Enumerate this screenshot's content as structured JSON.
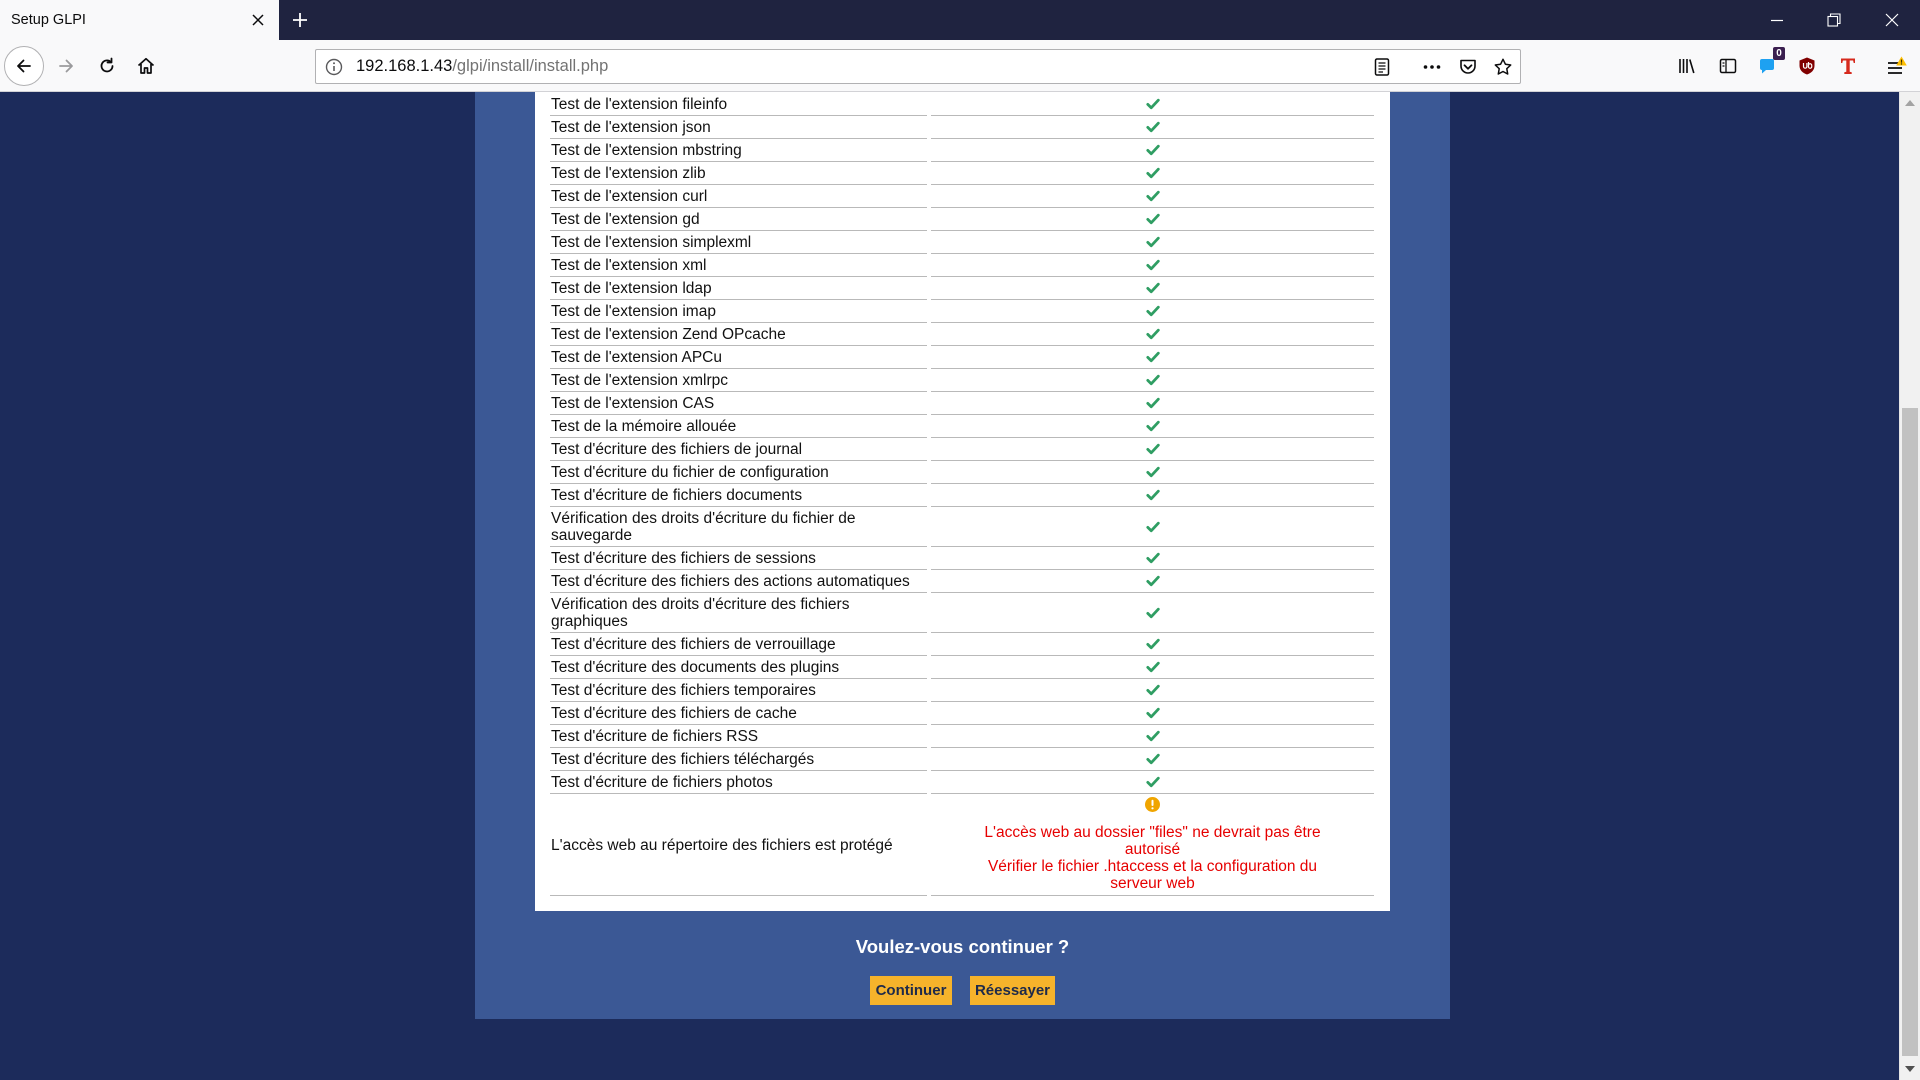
{
  "browser": {
    "tab_title": "Setup GLPI",
    "url_host": "192.168.1.43",
    "url_path": "/glpi/install/install.php",
    "extension_badge": "0",
    "toolbar_icons": [
      "back-icon",
      "forward-icon",
      "reload-icon",
      "home-icon",
      "site-info-icon",
      "reader-view-icon",
      "page-actions-icon",
      "pocket-icon",
      "bookmark-star-icon",
      "library-icon",
      "sidebar-icon",
      "extension-icon",
      "ublock-icon",
      "t-extension-icon",
      "menu-icon"
    ]
  },
  "page": {
    "checks": [
      {
        "label": "Test de l'extension fileinfo",
        "status": "ok"
      },
      {
        "label": "Test de l'extension json",
        "status": "ok"
      },
      {
        "label": "Test de l'extension mbstring",
        "status": "ok"
      },
      {
        "label": "Test de l'extension zlib",
        "status": "ok"
      },
      {
        "label": "Test de l'extension curl",
        "status": "ok"
      },
      {
        "label": "Test de l'extension gd",
        "status": "ok"
      },
      {
        "label": "Test de l'extension simplexml",
        "status": "ok"
      },
      {
        "label": "Test de l'extension xml",
        "status": "ok"
      },
      {
        "label": "Test de l'extension ldap",
        "status": "ok"
      },
      {
        "label": "Test de l'extension imap",
        "status": "ok"
      },
      {
        "label": "Test de l'extension Zend OPcache",
        "status": "ok"
      },
      {
        "label": "Test de l'extension APCu",
        "status": "ok"
      },
      {
        "label": "Test de l'extension xmlrpc",
        "status": "ok"
      },
      {
        "label": "Test de l'extension CAS",
        "status": "ok"
      },
      {
        "label": "Test de la mémoire allouée",
        "status": "ok"
      },
      {
        "label": "Test d'écriture des fichiers de journal",
        "status": "ok"
      },
      {
        "label": "Test d'écriture du fichier de configuration",
        "status": "ok"
      },
      {
        "label": "Test d'écriture de fichiers documents",
        "status": "ok"
      },
      {
        "label": "Vérification des droits d'écriture du fichier de sauvegarde",
        "status": "ok"
      },
      {
        "label": "Test d'écriture des fichiers de sessions",
        "status": "ok"
      },
      {
        "label": "Test d'écriture des fichiers des actions automatiques",
        "status": "ok"
      },
      {
        "label": "Vérification des droits d'écriture des fichiers graphiques",
        "status": "ok"
      },
      {
        "label": "Test d'écriture des fichiers de verrouillage",
        "status": "ok"
      },
      {
        "label": "Test d'écriture des documents des plugins",
        "status": "ok"
      },
      {
        "label": "Test d'écriture des fichiers temporaires",
        "status": "ok"
      },
      {
        "label": "Test d'écriture des fichiers de cache",
        "status": "ok"
      },
      {
        "label": "Test d'écriture de fichiers RSS",
        "status": "ok"
      },
      {
        "label": "Test d'écriture des fichiers téléchargés",
        "status": "ok"
      },
      {
        "label": "Test d'écriture de fichiers photos",
        "status": "ok"
      },
      {
        "label": "L'accès web au répertoire des fichiers est protégé",
        "status": "warning",
        "messages": [
          "L'accès web au dossier \"files\" ne devrait pas être autorisé",
          "Vérifier le fichier .htaccess et la configuration du serveur web"
        ]
      }
    ],
    "question": "Voulez-vous continuer ?",
    "continue_label": "Continuer",
    "retry_label": "Réessayer"
  },
  "colors": {
    "page_bg": "#1c2b5b",
    "panel_bg": "#3b5895",
    "ok": "#2f9e63",
    "warning": "#f0a500",
    "error_text": "#e60000",
    "button": "#f6b32b"
  }
}
